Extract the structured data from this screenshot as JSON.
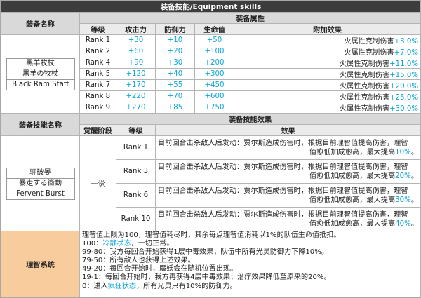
{
  "title": "装备技能/Equipment skills",
  "equip": {
    "name_header": "装备名称",
    "attr_header": "装备属性",
    "columns": [
      "等级",
      "攻击力",
      "防御力",
      "生命值",
      "附加效果"
    ],
    "names": [
      "黑羊牧杖",
      "黒羊の牧杖",
      "Black Ram Staff"
    ],
    "rows": [
      {
        "rank": "Rank 1",
        "atk": "+30",
        "def": "+10",
        "hp": "+50",
        "effect": "火属性克制伤害",
        "effect_val": "+3.0%"
      },
      {
        "rank": "Rank 2",
        "atk": "+60",
        "def": "+20",
        "hp": "+100",
        "effect": "火属性克制伤害",
        "effect_val": "+7.0%"
      },
      {
        "rank": "Rank 4",
        "atk": "+90",
        "def": "+30",
        "hp": "+200",
        "effect": "火属性克制伤害",
        "effect_val": "+11.0%"
      },
      {
        "rank": "Rank 5",
        "atk": "+120",
        "def": "+40",
        "hp": "+300",
        "effect": "火属性克制伤害",
        "effect_val": "+15.0%"
      },
      {
        "rank": "Rank 7",
        "atk": "+170",
        "def": "+55",
        "hp": "+450",
        "effect": "火属性克制伤害",
        "effect_val": "+20.0%"
      },
      {
        "rank": "Rank 8",
        "atk": "+220",
        "def": "+70",
        "hp": "+600",
        "effect": "火属性克制伤害",
        "effect_val": "+25.0%"
      },
      {
        "rank": "Rank 9",
        "atk": "+270",
        "def": "+85",
        "hp": "+750",
        "effect": "火属性克制伤害",
        "effect_val": "+30.0%"
      }
    ]
  },
  "skill": {
    "name_header": "装备技能名称",
    "effect_header": "装备技能效果",
    "columns": [
      "觉醒阶段",
      "等级",
      "效果"
    ],
    "names": [
      "骊破晏",
      "暴走する衝動",
      "Fervent Burst"
    ],
    "stage": "一觉",
    "rows": [
      {
        "rank": "Rank 1",
        "line1": "目前回合击杀敌人后发动：贾尔斯造成伤害时，根据目前理智值提高伤害，理智",
        "line2a": "值愈低加成愈高，最大提高",
        "val": "10%",
        "line2b": "。"
      },
      {
        "rank": "Rank 3",
        "line1": "目前回合击杀敌人后发动：贾尔斯造成伤害时，根据目前理智值提高伤害，理智",
        "line2a": "值愈低加成愈高，最大提高",
        "val": "20%",
        "line2b": "。"
      },
      {
        "rank": "Rank 6",
        "line1": "目前回合击杀敌人后发动：贾尔斯造成伤害时，根据目前理智值提高伤害，理智",
        "line2a": "值愈低加成愈高，最大提高",
        "val": "30%",
        "line2b": "。"
      },
      {
        "rank": "Rank 10",
        "line1": "目前回合击杀敌人后发动：贾尔斯造成伤害时，根据目前理智值提高伤害，理智",
        "line2a": "值愈低加成愈高，最大提高",
        "val": "40%",
        "line2b": "。"
      }
    ]
  },
  "sanity": {
    "label": "理智系统",
    "lines": [
      {
        "pre": "理智值上限为100，理智值耗尽时，其余每点理智值消耗以1%的队伍生命值抵扣。",
        "hl": "",
        "post": ""
      },
      {
        "pre": "100：",
        "hl": "冷静状态",
        "post": "，一切正常。"
      },
      {
        "pre": "99-80：我方每回合开始获得1层中毒效果；队伍中所有光灵防御力下降10%。",
        "hl": "",
        "post": ""
      },
      {
        "pre": "79-50：所有敌人也获得上述效果。",
        "hl": "",
        "post": ""
      },
      {
        "pre": "49-20：每回合开始时，魔妖会在随机位置出现。",
        "hl": "",
        "post": ""
      },
      {
        "pre": "19-1：每回合开始时，我方再获得4层中毒效果；治疗效果降低至原来的20%。",
        "hl": "",
        "post": ""
      },
      {
        "pre": "0：进入",
        "hl": "疯狂状态",
        "post": "，所有光灵只有10%的防御力。"
      }
    ]
  },
  "colors": {
    "accent": "#0aa4d8",
    "header_dark": "#3d3d3d",
    "sanity_label_bg": "#f9cc9d"
  }
}
